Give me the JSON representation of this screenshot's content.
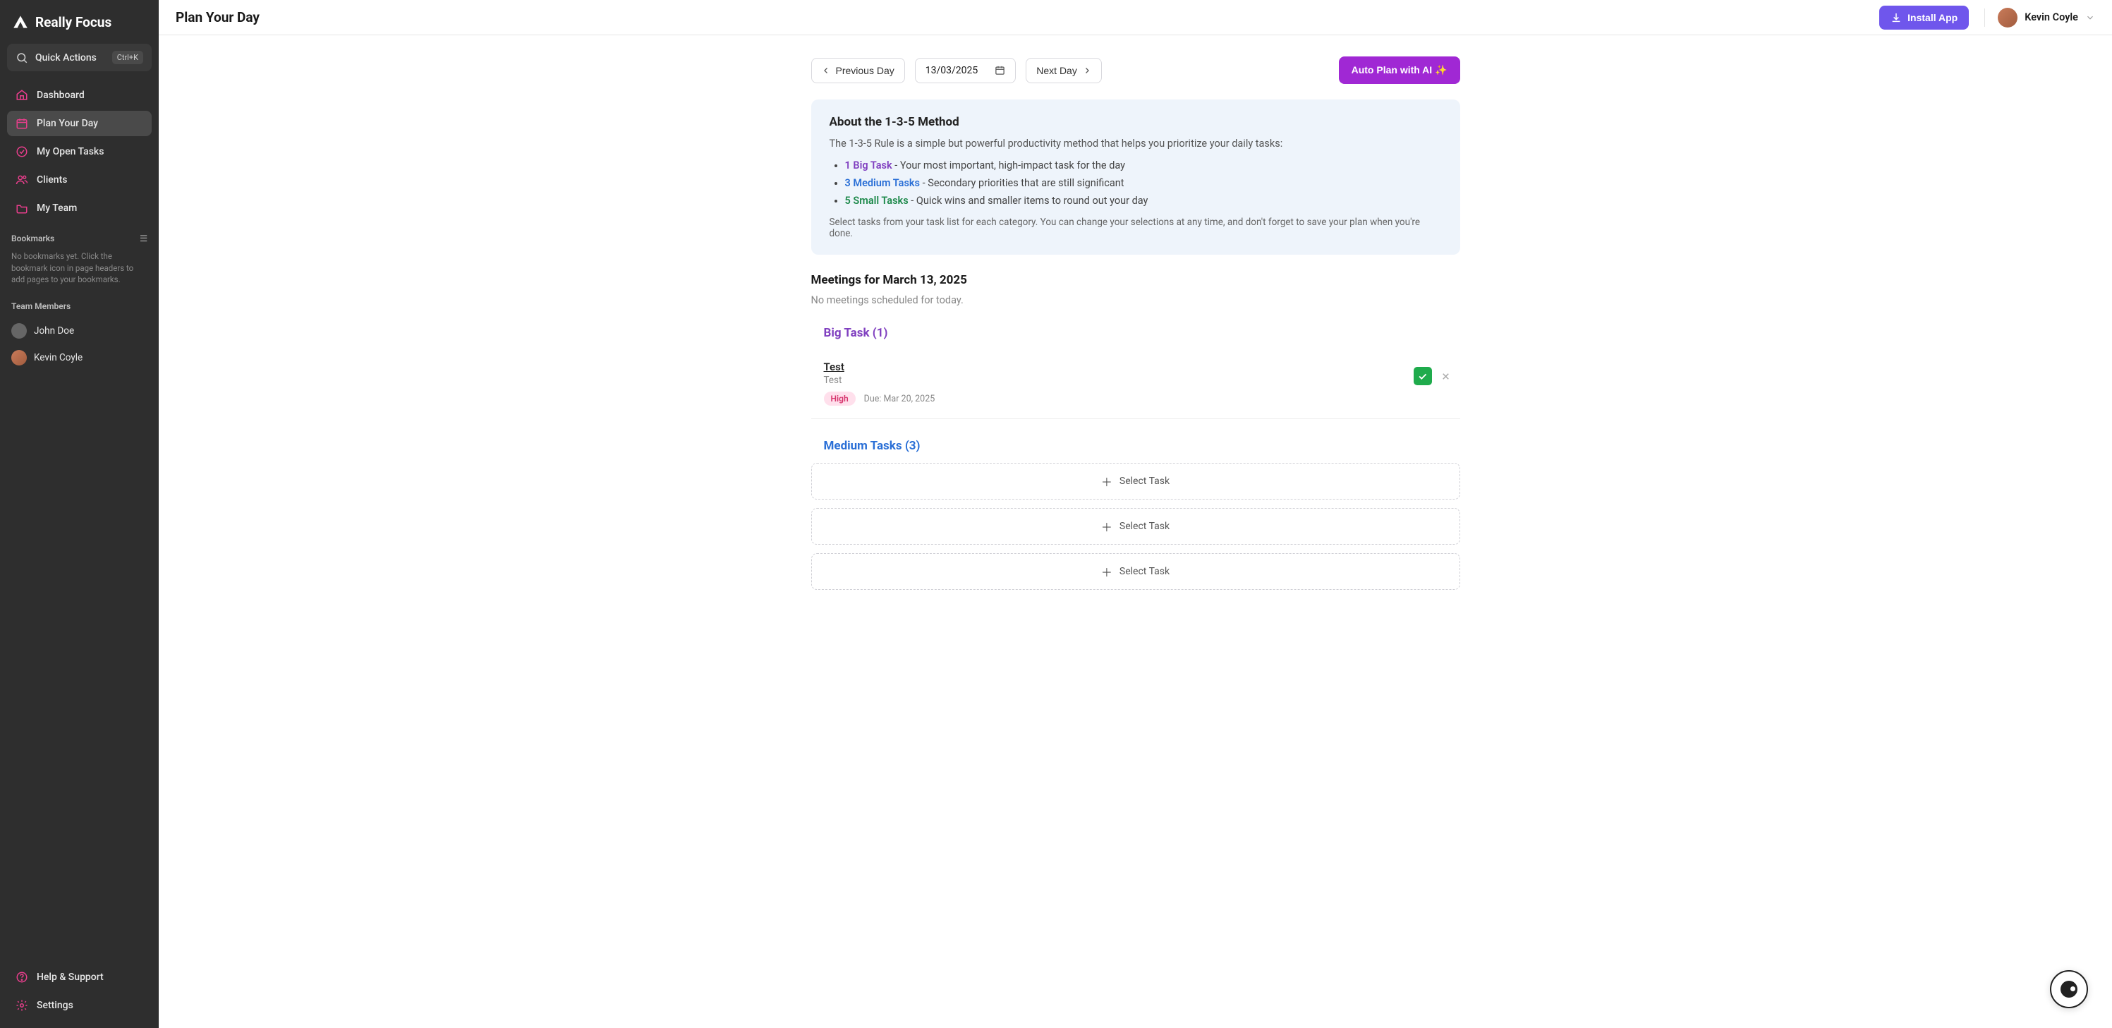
{
  "brand": {
    "name": "Really Focus"
  },
  "quickActions": {
    "label": "Quick Actions",
    "shortcut": "Ctrl+K"
  },
  "nav": {
    "dashboard": "Dashboard",
    "planYourDay": "Plan Your Day",
    "myOpenTasks": "My Open Tasks",
    "clients": "Clients",
    "myTeam": "My Team"
  },
  "bookmarks": {
    "label": "Bookmarks",
    "empty": "No bookmarks yet. Click the bookmark icon in page headers to add pages to your bookmarks."
  },
  "teamSection": {
    "label": "Team Members"
  },
  "teamMembers": [
    {
      "name": "John Doe"
    },
    {
      "name": "Kevin Coyle"
    }
  ],
  "footerNav": {
    "help": "Help & Support",
    "settings": "Settings"
  },
  "topbar": {
    "title": "Plan Your Day",
    "install": "Install App",
    "userName": "Kevin Coyle"
  },
  "dateNav": {
    "prev": "Previous Day",
    "date": "13/03/2025",
    "next": "Next Day",
    "aiButton": "Auto Plan with AI ✨"
  },
  "info": {
    "title": "About the 1-3-5 Method",
    "desc": "The 1-3-5 Rule is a simple but powerful productivity method that helps you prioritize your daily tasks:",
    "bullets": [
      {
        "strong": "1 Big Task",
        "rest": " - Your most important, high-impact task for the day"
      },
      {
        "strong": "3 Medium Tasks",
        "rest": " - Secondary priorities that are still significant"
      },
      {
        "strong": "5 Small Tasks",
        "rest": " - Quick wins and smaller items to round out your day"
      }
    ],
    "foot": "Select tasks from your task list for each category. You can change your selections at any time, and don't forget to save your plan when you're done."
  },
  "meetings": {
    "heading": "Meetings for March 13, 2025",
    "empty": "No meetings scheduled for today."
  },
  "bigTask": {
    "heading": "Big Task (1)",
    "task": {
      "title": "Test",
      "subtitle": "Test",
      "priority": "High",
      "due": "Due: Mar 20, 2025"
    }
  },
  "mediumTasks": {
    "heading": "Medium Tasks (3)",
    "selectLabel": "Select Task"
  }
}
